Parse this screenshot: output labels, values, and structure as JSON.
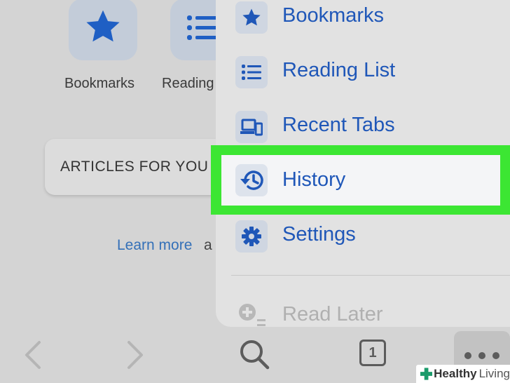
{
  "shortcuts": [
    {
      "label": "Bookmarks",
      "icon": "star-icon"
    },
    {
      "label": "Reading",
      "icon": "list-icon"
    }
  ],
  "articles_card": {
    "text": "ARTICLES FOR YOU"
  },
  "learn_more": {
    "link": "Learn more",
    "tail": "a"
  },
  "menu": {
    "items": [
      {
        "label": "Bookmarks",
        "icon": "star-icon"
      },
      {
        "label": "Reading List",
        "icon": "list-icon"
      },
      {
        "label": "Recent Tabs",
        "icon": "devices-icon"
      },
      {
        "label": "History",
        "icon": "history-icon",
        "highlighted": true
      },
      {
        "label": "Settings",
        "icon": "gear-icon"
      },
      {
        "label": "Read Later",
        "icon": "read-later-icon",
        "disabled": true
      }
    ]
  },
  "toolbar": {
    "tab_count": "1",
    "icons": [
      "back-icon",
      "forward-icon",
      "search-icon",
      "tabs-icon",
      "more-icon"
    ]
  },
  "watermark": {
    "text_bold": "Healthy",
    "text_light": "Living"
  },
  "colors": {
    "accent": "#1f57b8",
    "highlight": "#3ce633",
    "link": "#3470b8"
  }
}
